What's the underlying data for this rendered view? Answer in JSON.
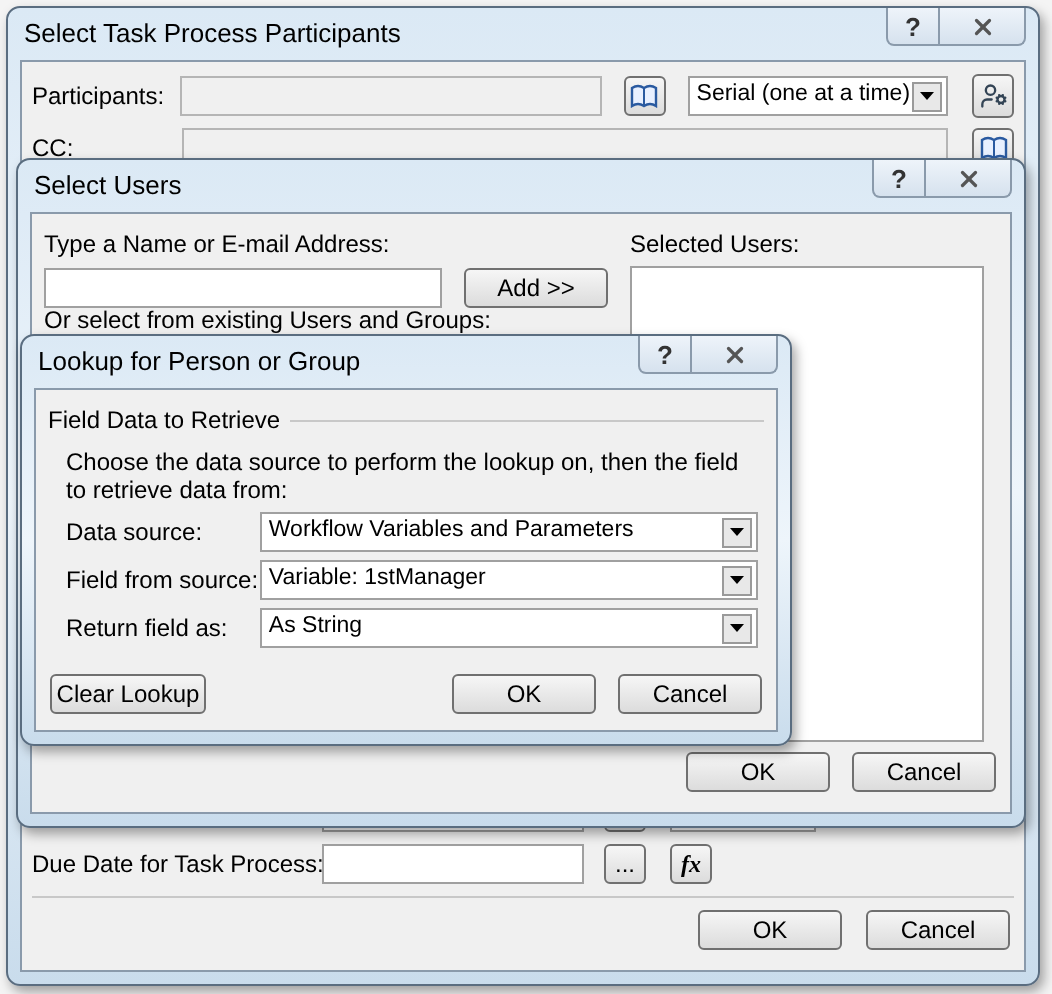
{
  "main_dialog": {
    "title": "Select Task Process Participants",
    "help_glyph": "?",
    "participants": {
      "label": "Participants:",
      "mode": "Serial (one at a time)"
    },
    "cc": {
      "label": "CC:"
    },
    "due_date": {
      "label": "Due Date for Task Process:",
      "browse": "...",
      "formula": "fx"
    },
    "buttons": [
      "OK",
      "Cancel"
    ]
  },
  "select_users": {
    "title": "Select Users",
    "help_glyph": "?",
    "name_label": "Type a Name or E-mail Address:",
    "add": "Add >>",
    "existing_label": "Or select from existing Users and Groups:",
    "selected_label": "Selected Users:",
    "buttons": [
      "OK",
      "Cancel"
    ]
  },
  "lookup": {
    "title": "Lookup for Person or Group",
    "help_glyph": "?",
    "group_title": "Field Data to Retrieve",
    "description": "Choose the data source to perform the lookup on, then the field to retrieve data from:",
    "rows": [
      {
        "label": "Data source:",
        "value": "Workflow Variables and Parameters"
      },
      {
        "label": "Field from source:",
        "value": "Variable: 1stManager"
      },
      {
        "label": "Return field as:",
        "value": "As String"
      }
    ],
    "clear": "Clear Lookup",
    "buttons": [
      "OK",
      "Cancel"
    ]
  }
}
